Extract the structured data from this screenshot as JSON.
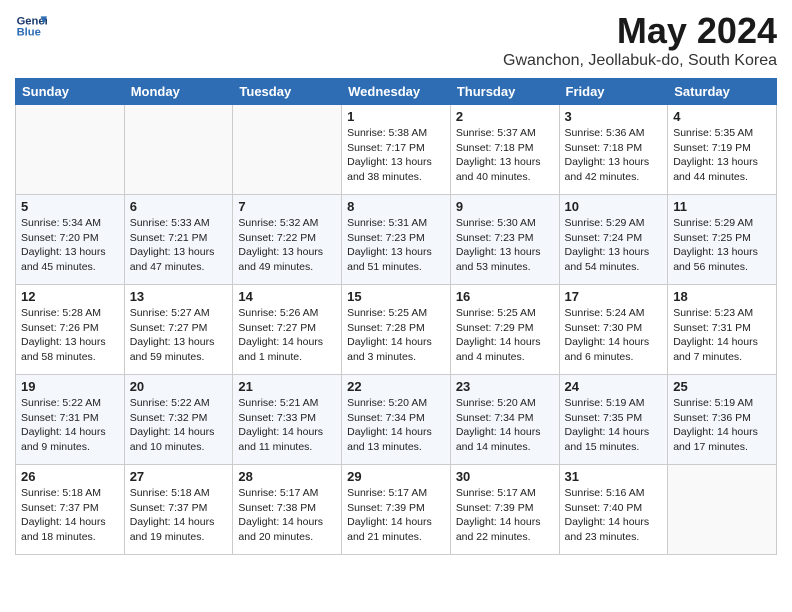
{
  "header": {
    "logo_line1": "General",
    "logo_line2": "Blue",
    "month": "May 2024",
    "location": "Gwanchon, Jeollabuk-do, South Korea"
  },
  "weekdays": [
    "Sunday",
    "Monday",
    "Tuesday",
    "Wednesday",
    "Thursday",
    "Friday",
    "Saturday"
  ],
  "weeks": [
    [
      {
        "day": "",
        "info": ""
      },
      {
        "day": "",
        "info": ""
      },
      {
        "day": "",
        "info": ""
      },
      {
        "day": "1",
        "info": "Sunrise: 5:38 AM\nSunset: 7:17 PM\nDaylight: 13 hours\nand 38 minutes."
      },
      {
        "day": "2",
        "info": "Sunrise: 5:37 AM\nSunset: 7:18 PM\nDaylight: 13 hours\nand 40 minutes."
      },
      {
        "day": "3",
        "info": "Sunrise: 5:36 AM\nSunset: 7:18 PM\nDaylight: 13 hours\nand 42 minutes."
      },
      {
        "day": "4",
        "info": "Sunrise: 5:35 AM\nSunset: 7:19 PM\nDaylight: 13 hours\nand 44 minutes."
      }
    ],
    [
      {
        "day": "5",
        "info": "Sunrise: 5:34 AM\nSunset: 7:20 PM\nDaylight: 13 hours\nand 45 minutes."
      },
      {
        "day": "6",
        "info": "Sunrise: 5:33 AM\nSunset: 7:21 PM\nDaylight: 13 hours\nand 47 minutes."
      },
      {
        "day": "7",
        "info": "Sunrise: 5:32 AM\nSunset: 7:22 PM\nDaylight: 13 hours\nand 49 minutes."
      },
      {
        "day": "8",
        "info": "Sunrise: 5:31 AM\nSunset: 7:23 PM\nDaylight: 13 hours\nand 51 minutes."
      },
      {
        "day": "9",
        "info": "Sunrise: 5:30 AM\nSunset: 7:23 PM\nDaylight: 13 hours\nand 53 minutes."
      },
      {
        "day": "10",
        "info": "Sunrise: 5:29 AM\nSunset: 7:24 PM\nDaylight: 13 hours\nand 54 minutes."
      },
      {
        "day": "11",
        "info": "Sunrise: 5:29 AM\nSunset: 7:25 PM\nDaylight: 13 hours\nand 56 minutes."
      }
    ],
    [
      {
        "day": "12",
        "info": "Sunrise: 5:28 AM\nSunset: 7:26 PM\nDaylight: 13 hours\nand 58 minutes."
      },
      {
        "day": "13",
        "info": "Sunrise: 5:27 AM\nSunset: 7:27 PM\nDaylight: 13 hours\nand 59 minutes."
      },
      {
        "day": "14",
        "info": "Sunrise: 5:26 AM\nSunset: 7:27 PM\nDaylight: 14 hours\nand 1 minute."
      },
      {
        "day": "15",
        "info": "Sunrise: 5:25 AM\nSunset: 7:28 PM\nDaylight: 14 hours\nand 3 minutes."
      },
      {
        "day": "16",
        "info": "Sunrise: 5:25 AM\nSunset: 7:29 PM\nDaylight: 14 hours\nand 4 minutes."
      },
      {
        "day": "17",
        "info": "Sunrise: 5:24 AM\nSunset: 7:30 PM\nDaylight: 14 hours\nand 6 minutes."
      },
      {
        "day": "18",
        "info": "Sunrise: 5:23 AM\nSunset: 7:31 PM\nDaylight: 14 hours\nand 7 minutes."
      }
    ],
    [
      {
        "day": "19",
        "info": "Sunrise: 5:22 AM\nSunset: 7:31 PM\nDaylight: 14 hours\nand 9 minutes."
      },
      {
        "day": "20",
        "info": "Sunrise: 5:22 AM\nSunset: 7:32 PM\nDaylight: 14 hours\nand 10 minutes."
      },
      {
        "day": "21",
        "info": "Sunrise: 5:21 AM\nSunset: 7:33 PM\nDaylight: 14 hours\nand 11 minutes."
      },
      {
        "day": "22",
        "info": "Sunrise: 5:20 AM\nSunset: 7:34 PM\nDaylight: 14 hours\nand 13 minutes."
      },
      {
        "day": "23",
        "info": "Sunrise: 5:20 AM\nSunset: 7:34 PM\nDaylight: 14 hours\nand 14 minutes."
      },
      {
        "day": "24",
        "info": "Sunrise: 5:19 AM\nSunset: 7:35 PM\nDaylight: 14 hours\nand 15 minutes."
      },
      {
        "day": "25",
        "info": "Sunrise: 5:19 AM\nSunset: 7:36 PM\nDaylight: 14 hours\nand 17 minutes."
      }
    ],
    [
      {
        "day": "26",
        "info": "Sunrise: 5:18 AM\nSunset: 7:37 PM\nDaylight: 14 hours\nand 18 minutes."
      },
      {
        "day": "27",
        "info": "Sunrise: 5:18 AM\nSunset: 7:37 PM\nDaylight: 14 hours\nand 19 minutes."
      },
      {
        "day": "28",
        "info": "Sunrise: 5:17 AM\nSunset: 7:38 PM\nDaylight: 14 hours\nand 20 minutes."
      },
      {
        "day": "29",
        "info": "Sunrise: 5:17 AM\nSunset: 7:39 PM\nDaylight: 14 hours\nand 21 minutes."
      },
      {
        "day": "30",
        "info": "Sunrise: 5:17 AM\nSunset: 7:39 PM\nDaylight: 14 hours\nand 22 minutes."
      },
      {
        "day": "31",
        "info": "Sunrise: 5:16 AM\nSunset: 7:40 PM\nDaylight: 14 hours\nand 23 minutes."
      },
      {
        "day": "",
        "info": ""
      }
    ]
  ]
}
